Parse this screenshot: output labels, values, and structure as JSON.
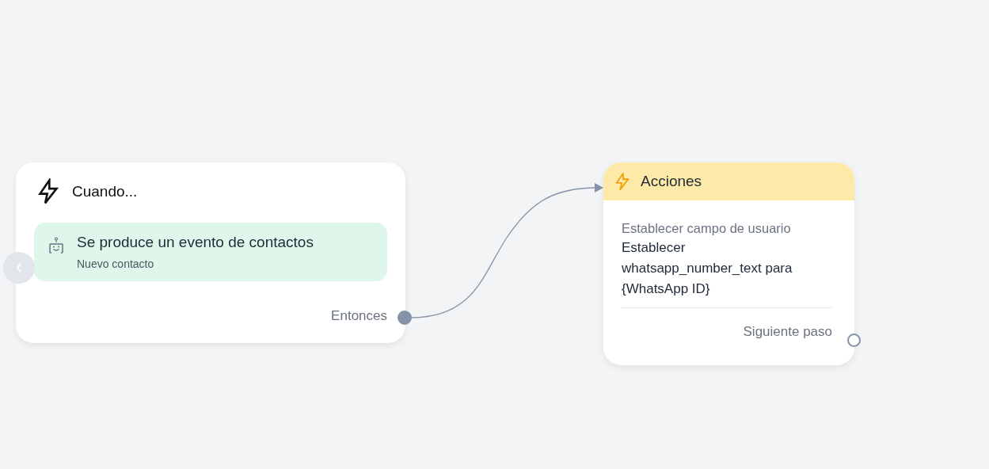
{
  "nodes": [
    {
      "kind": "trigger",
      "title": "Cuando...",
      "event": {
        "title": "Se produce un evento de contactos",
        "subtitle": "Nuevo contacto"
      },
      "output": {
        "label": "Entonces",
        "connected": true
      }
    },
    {
      "kind": "action",
      "title": "Acciones",
      "step": {
        "title": "Establecer campo de usuario",
        "description": "Establecer whatsapp_number_text para {WhatsApp ID}"
      },
      "output": {
        "label": "Siguiente paso",
        "connected": false
      }
    }
  ]
}
